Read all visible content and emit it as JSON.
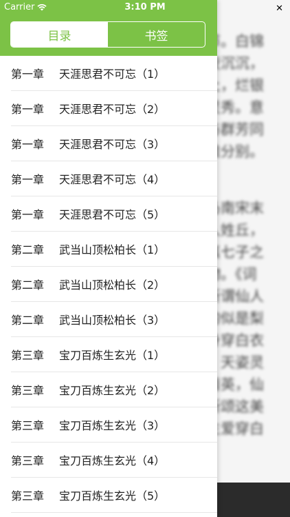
{
  "status_bar": {
    "carrier": "Carrier",
    "time": "3:10 PM"
  },
  "tabs": [
    {
      "label": "目录",
      "active": true
    },
    {
      "label": "书签",
      "active": false
    }
  ],
  "toc": [
    {
      "chapter": "第一章",
      "title": "天涯思君不可忘（1）"
    },
    {
      "chapter": "第一章",
      "title": "天涯思君不可忘（2）"
    },
    {
      "chapter": "第一章",
      "title": "天涯思君不可忘（3）"
    },
    {
      "chapter": "第一章",
      "title": "天涯思君不可忘（4）"
    },
    {
      "chapter": "第一章",
      "title": "天涯思君不可忘（5）"
    },
    {
      "chapter": "第二章",
      "title": "武当山顶松柏长（1）"
    },
    {
      "chapter": "第二章",
      "title": "武当山顶松柏长（2）"
    },
    {
      "chapter": "第二章",
      "title": "武当山顶松柏长（3）"
    },
    {
      "chapter": "第三章",
      "title": "宝刀百炼生玄光（1）"
    },
    {
      "chapter": "第三章",
      "title": "宝刀百炼生玄光（2）"
    },
    {
      "chapter": "第三章",
      "title": "宝刀百炼生玄光（3）"
    },
    {
      "chapter": "第三章",
      "title": "宝刀百炼生玄光（4）"
    },
    {
      "chapter": "第三章",
      "title": "宝刀百炼生玄光（5）"
    }
  ],
  "reader": {
    "close_label": "✕",
    "lines_top": [
      "节。白锦",
      "夜沉沉，",
      "上，烂银",
      "灵秀。意",
      "与群芳同",
      "难分别。"
    ],
    "lines_bottom": [
      "乃南宋末",
      "人姓丘，",
      "真七子之",
      "物。《词",
      "所谓仙人",
      "的似是梨",
      "身穿白衣",
      "，天姿灵",
      "清英，仙",
      "所颂这美",
      "生爱穿白"
    ]
  },
  "colors": {
    "accent": "#7cc246",
    "footer": "#2b2b2b"
  }
}
